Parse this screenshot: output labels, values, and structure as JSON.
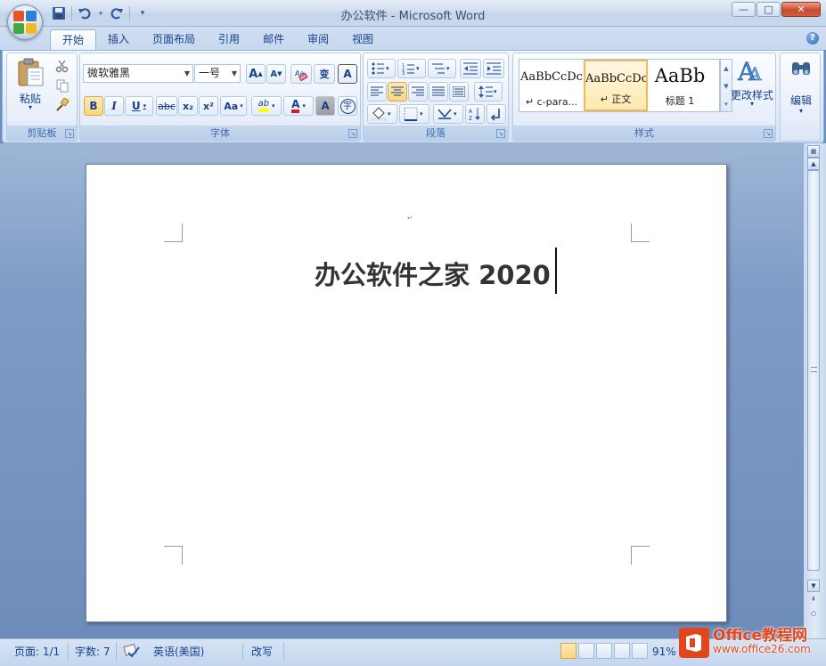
{
  "window": {
    "title": "办公软件 - Microsoft Word",
    "minimize": "—",
    "maximize": "□",
    "close": "✕"
  },
  "qat": {
    "icons": [
      "save-icon",
      "undo-icon",
      "redo-icon",
      "customize-qat-icon"
    ]
  },
  "tabs": [
    {
      "label": "开始",
      "active": true
    },
    {
      "label": "插入"
    },
    {
      "label": "页面布局"
    },
    {
      "label": "引用"
    },
    {
      "label": "邮件"
    },
    {
      "label": "审阅"
    },
    {
      "label": "视图"
    }
  ],
  "help": "?",
  "clipboard": {
    "paste_label": "粘贴",
    "group_label": "剪贴板"
  },
  "font": {
    "font_name": "微软雅黑",
    "font_size": "一号",
    "grow": "A",
    "shrink": "A",
    "bold": "B",
    "italic": "I",
    "underline": "U",
    "strike": "abc",
    "subscript": "x₂",
    "superscript": "x²",
    "change_case": "Aa",
    "highlight": "ab",
    "font_color": "A",
    "char_shade": "A",
    "enclose": "字",
    "phonetic": "变",
    "char_border": "A",
    "group_label": "字体"
  },
  "paragraph": {
    "group_label": "段落"
  },
  "styles": {
    "tiles": [
      {
        "sample": "AaBbCcDc",
        "name": "↵ c-para..."
      },
      {
        "sample": "AaBbCcDc",
        "name": "↵ 正文"
      },
      {
        "sample": "AaBb",
        "name": "标题 1"
      }
    ],
    "change_styles": "更改样式",
    "group_label": "样式"
  },
  "editing": {
    "label": "编辑"
  },
  "document": {
    "text": "办公软件之家 2020"
  },
  "status": {
    "page": "页面: 1/1",
    "words": "字数: 7",
    "language": "英语(美国)",
    "insert_mode": "改写",
    "zoom": "91%"
  },
  "watermark": {
    "line1": "Office教程网",
    "line2": "www.office26.com"
  },
  "colors": {
    "accent": "#15428b",
    "ribbon_border": "#8db2e3",
    "selected": "#fbd67f",
    "font_color_bar": "#e8141c",
    "highlight_bar": "#ffff00",
    "watermark": "#e3461c"
  }
}
